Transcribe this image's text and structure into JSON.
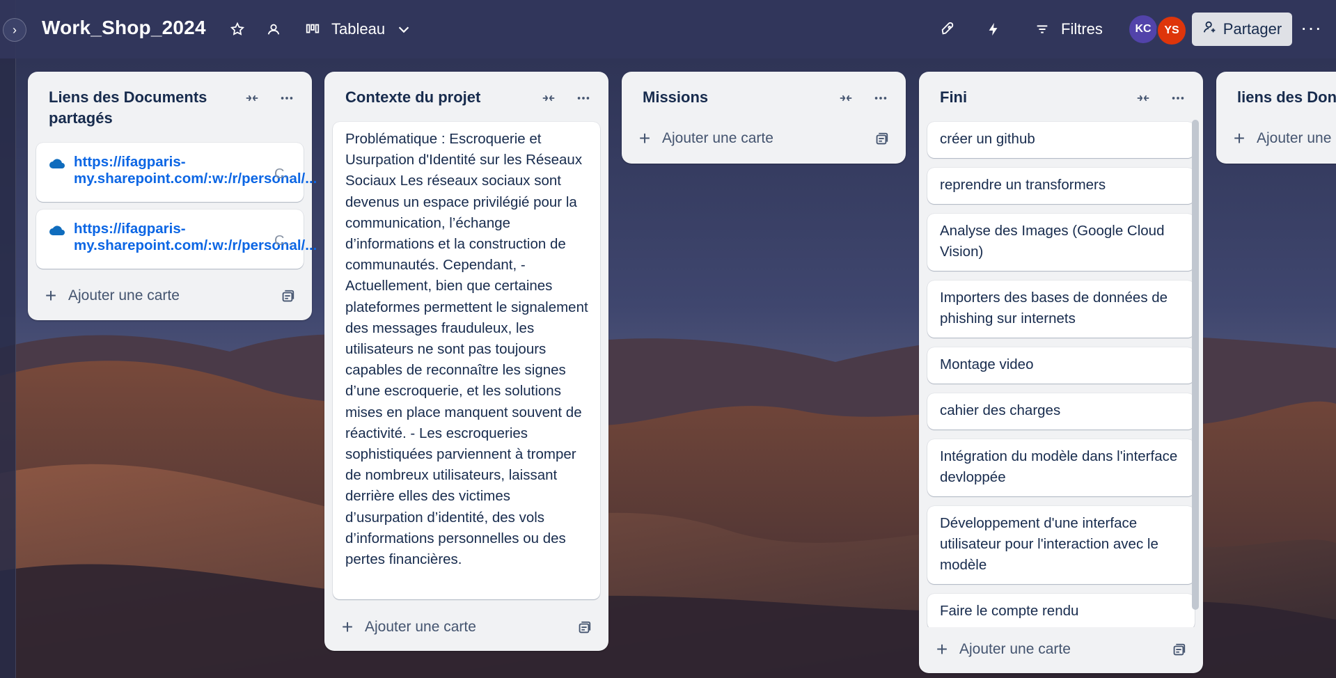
{
  "header": {
    "board_title": "Work_Shop_2024",
    "view_label": "Tableau",
    "filters_label": "Filtres",
    "share_label": "Partager",
    "more_label": "···",
    "avatars": [
      {
        "initials": "KC",
        "color": "#5243aa"
      },
      {
        "initials": "YS",
        "color": "#de350b"
      }
    ]
  },
  "lists": [
    {
      "title": "Liens des Documents partagés",
      "cards": [
        {
          "link": "https://ifagparis-my.sharepoint.com/:w:/r/personal/...",
          "tail": "C.."
        },
        {
          "link": "https://ifagparis-my.sharepoint.com/:w:/r/personal/...",
          "tail": "C.."
        }
      ],
      "add_label": "Ajouter une carte"
    },
    {
      "title": "Contexte du projet",
      "cards": [
        {
          "text": "Problématique : Escroquerie et Usurpation d'Identité sur les Réseaux Sociaux Les réseaux sociaux sont devenus un espace privilégié pour la communication, l’échange d’informations et la construction de communautés. Cependant, - Actuellement, bien que certaines plateformes permettent le signalement des messages frauduleux, les utilisateurs ne sont pas toujours capables de reconnaître les signes d’une escroquerie, et les solutions mises en place manquent souvent de réactivité. - Les escroqueries sophistiquées parviennent à tromper de nombreux utilisateurs, laissant derrière elles des victimes d’usurpation d’identité, des vols d’informations personnelles ou des pertes financières."
        }
      ],
      "add_label": "Ajouter une carte"
    },
    {
      "title": "Missions",
      "cards": [],
      "add_label": "Ajouter une carte"
    },
    {
      "title": "Fini",
      "cards": [
        {
          "text": "créer un github"
        },
        {
          "text": "reprendre un transformers"
        },
        {
          "text": "Analyse des Images (Google Cloud Vision)"
        },
        {
          "text": "Importers des bases de données de phishing sur internets"
        },
        {
          "text": "Montage video"
        },
        {
          "text": "cahier des charges"
        },
        {
          "text": "Intégration du modèle dans l'interface devloppée"
        },
        {
          "text": "Développement d'une interface utilisateur pour l'interaction avec le modèle"
        },
        {
          "text": "Faire le compte rendu"
        }
      ],
      "add_label": "Ajouter une carte"
    },
    {
      "title": "liens des Donn",
      "cards": [],
      "add_label": "Ajouter une"
    }
  ],
  "colors": {
    "header_bg": "#32375c",
    "list_bg": "#f1f2f4",
    "link": "#0c66e4",
    "share_bg": "#dfe1e6"
  }
}
